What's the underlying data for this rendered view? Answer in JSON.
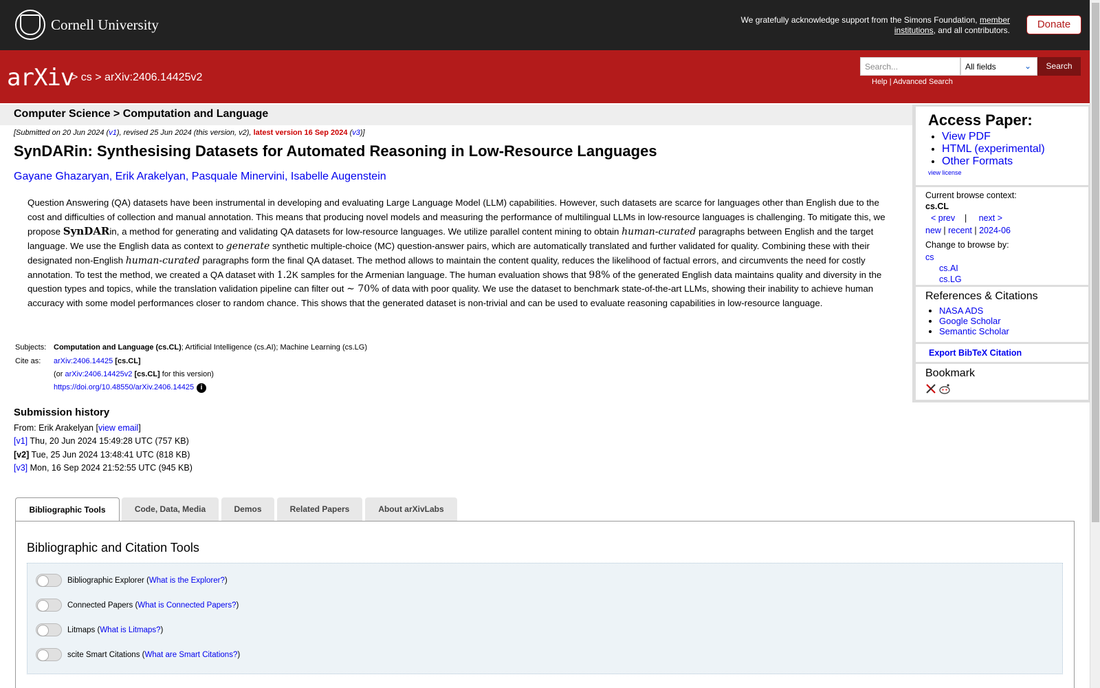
{
  "header": {
    "university": "Cornell University",
    "ack_text": "We gratefully acknowledge support from the Simons Foundation,",
    "ack_link": "member institutions",
    "ack_tail": ", and all contributors.",
    "donate_label": "Donate"
  },
  "nav": {
    "logo_text": "arXiv",
    "breadcrumb_sep1": ">",
    "breadcrumb_cat": "cs",
    "breadcrumb_sep2": ">",
    "breadcrumb_id": "arXiv:2406.14425v2",
    "search_placeholder": "Search...",
    "field_select": "All fields",
    "search_button": "Search",
    "help_label": "Help",
    "help_sep": "|",
    "advanced_label": "Advanced Search"
  },
  "paper": {
    "subject_header": "Computer Science > Computation and Language",
    "date_prefix": "[Submitted on 20 Jun 2024 (",
    "v1_link": "v1",
    "date_mid": "), revised 25 Jun 2024 (this version, v2), ",
    "latest": "latest version 16 Sep 2024",
    "date_v3_open": " (",
    "v3_link": "v3",
    "date_end": ")]",
    "title": "SynDARin: Synthesising Datasets for Automated Reasoning in Low-Resource Languages",
    "authors": [
      "Gayane Ghazaryan",
      "Erik Arakelyan",
      "Pasquale Minervini",
      "Isabelle Augenstein"
    ],
    "abstract": [
      "Question Answering (QA) datasets have been instrumental in developing and evaluating Large Language Model (LLM) capabilities. However, such datasets are scarce for languages other than English due to the cost and difficulties of collection and manual annotation. This means that producing novel models and measuring the performance of multilingual LLMs in low-resource languages is challenging. To mitigate this, we propose ",
      "SynDAR",
      "in, a method for generating and validating QA datasets for low-resource languages. We utilize parallel content mining to obtain ",
      "human-curated",
      " paragraphs between English and the target language. We use the English data as context to ",
      "generate",
      " synthetic multiple-choice (MC) question-answer pairs, which are automatically translated and further validated for quality. Combining these with their designated non-English ",
      "human-curated",
      " paragraphs form the final QA dataset. The method allows to maintain the content quality, reduces the likelihood of factual errors, and circumvents the need for costly annotation. To test the method, we created a QA dataset with ",
      "1.2",
      "K samples for the Armenian language. The human evaluation shows that ",
      "98%",
      " of the generated English data maintains quality and diversity in the question types and topics, while the translation validation pipeline can filter out ",
      "∼ 70%",
      " of data with poor quality. We use the dataset to benchmark state-of-the-art LLMs, showing their inability to achieve human accuracy with some model performances closer to random chance. This shows that the generated dataset is non-trivial and can be used to evaluate reasoning capabilities in low-resource language."
    ],
    "subjects_label": "Subjects:",
    "subjects_primary": "Computation and Language (cs.CL)",
    "subjects_rest": "; Artificial Intelligence (cs.AI); Machine Learning (cs.LG)",
    "cite_label": "Cite as:",
    "cite_id": "arXiv:2406.14425",
    "cite_cat": "[cs.CL]",
    "cite2_open": "(or",
    "cite2_id": "arXiv:2406.14425v2",
    "cite2_cat": "[cs.CL]",
    "cite2_tail": "for this version)",
    "doi": "https://doi.org/10.48550/arXiv.2406.14425",
    "info_glyph": "i"
  },
  "history": {
    "heading": "Submission history",
    "from_prefix": "From: Erik Arakelyan [",
    "view_email": "view email",
    "from_suffix": "]",
    "versions": [
      {
        "tag": "[v1]",
        "text": "Thu, 20 Jun 2024 15:49:28 UTC (757 KB)"
      },
      {
        "tag": "[v2]",
        "text": "Tue, 25 Jun 2024 13:48:41 UTC (818 KB)"
      },
      {
        "tag": "[v3]",
        "text": "Mon, 16 Sep 2024 21:52:55 UTC (945 KB)"
      }
    ]
  },
  "sidebar": {
    "access_heading": "Access Paper:",
    "access_links": [
      "View PDF",
      "HTML (experimental)",
      "Other Formats"
    ],
    "view_license": "view license",
    "context_label": "Current browse context:",
    "context_value": "cs.CL",
    "prev": "< prev",
    "pipe": "|",
    "next": "next >",
    "new": "new",
    "recent": "recent",
    "month": "2024-06",
    "change_label": "Change to browse by:",
    "browse": [
      "cs",
      "cs.AI",
      "cs.LG"
    ],
    "refs_heading": "References & Citations",
    "refs_links": [
      "NASA ADS",
      "Google Scholar",
      "Semantic Scholar"
    ],
    "bibtex": "Export BibTeX Citation",
    "bookmark_heading": "Bookmark"
  },
  "tabs": {
    "items": [
      "Bibliographic Tools",
      "Code, Data, Media",
      "Demos",
      "Related Papers",
      "About arXivLabs"
    ],
    "panel_heading": "Bibliographic and Citation Tools",
    "tools": [
      {
        "label": "Bibliographic Explorer",
        "link": "What is the Explorer?"
      },
      {
        "label": "Connected Papers",
        "link": "What is Connected Papers?"
      },
      {
        "label": "Litmaps",
        "link": "What is Litmaps?"
      },
      {
        "label": "scite Smart Citations",
        "link": "What are Smart Citations?"
      }
    ]
  },
  "colors": {
    "brand_red": "#b31b1b",
    "dark": "#222222",
    "link": "#0000ee"
  }
}
